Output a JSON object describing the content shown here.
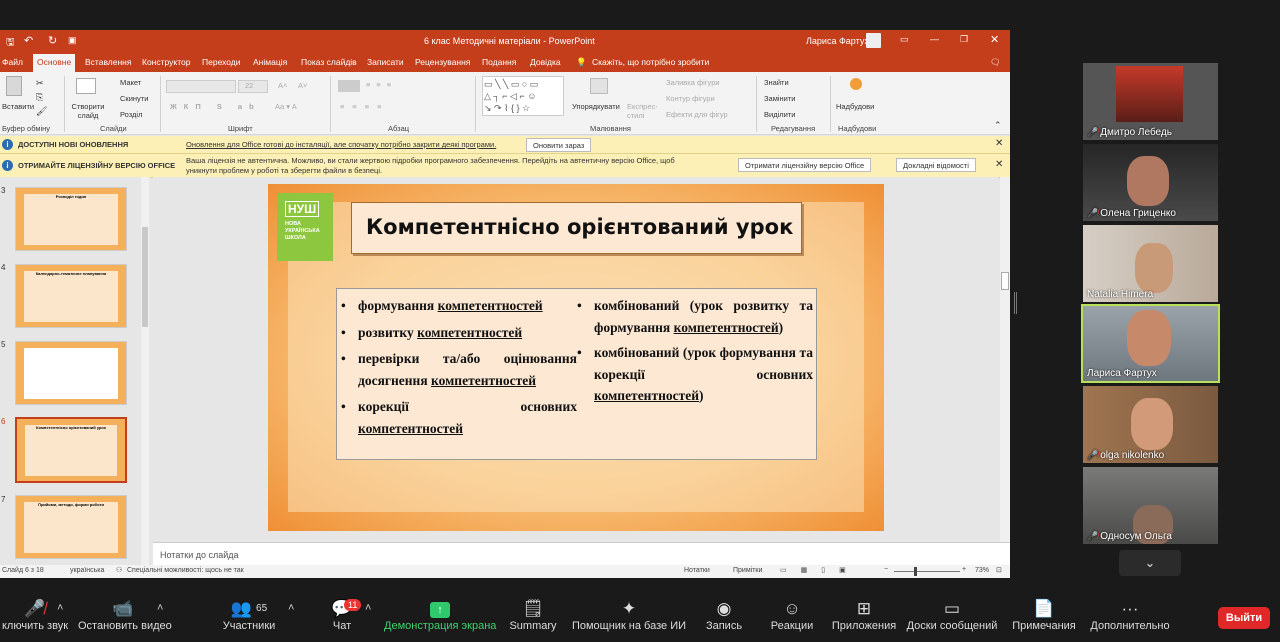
{
  "powerpoint": {
    "title": "6 клас Методичні матеріали  -  PowerPoint",
    "user": "Лариса Фартух",
    "tabs": [
      "Файл",
      "Основне",
      "Вставлення",
      "Конструктор",
      "Переходи",
      "Анімація",
      "Показ слайдів",
      "Записати",
      "Рецензування",
      "Подання",
      "Довідка"
    ],
    "tell_me": "Скажіть, що потрібно зробити",
    "ribbon": {
      "paste": "Вставити",
      "clipboard": "Буфер обміну",
      "new_slide": "Створити слайд",
      "layout": "Макет",
      "reset": "Скинути",
      "section": "Розділ",
      "slides": "Слайди",
      "font": "Шрифт",
      "font_size": "22",
      "paragraph": "Абзац",
      "arrange": "Упорядкувати",
      "quick_styles": "Експрес-стилі",
      "shape_fill": "Заливка фігури",
      "shape_outline": "Контур фігури",
      "shape_effects": "Ефекти для фігур",
      "drawing": "Малювання",
      "find": "Знайти",
      "replace": "Замінити",
      "select": "Виділити",
      "editing": "Редагування",
      "addins_btn": "Надбудови",
      "addins": "Надбудови"
    },
    "update_bar": {
      "title": "ДОСТУПНІ НОВІ ОНОВЛЕННЯ",
      "text": "Оновлення для Office готові до інсталяції, але спочатку потрібно закрити деякі програми.",
      "button": "Оновити зараз"
    },
    "license_bar": {
      "title": "ОТРИМАЙТЕ ЛІЦЕНЗІЙНУ ВЕРСІЮ OFFICE",
      "text1": "Ваша ліцензія не автентична. Можливо, ви стали жертвою підробки програмного забезпечення. Перейдіть на автентичну версію Office, щоб",
      "text2": "уникнути проблем у роботі та зберегти файли в безпеці.",
      "button1": "Отримати ліцензійну версію Office",
      "button2": "Докладні відомості"
    },
    "thumbnails": [
      {
        "num": "3",
        "title": "Розподіл годин"
      },
      {
        "num": "4",
        "title": "Календарно-тематичне планування"
      },
      {
        "num": "5",
        "title": ""
      },
      {
        "num": "6",
        "title": "Компетентнісно орієнтований урок"
      },
      {
        "num": "7",
        "title": "Прийоми, методи, форми роботи"
      }
    ],
    "slide": {
      "logo_big": "НУШ",
      "logo_sub1": "НОВА",
      "logo_sub2": "УКРАЇНСЬКА",
      "logo_sub3": "ШКОЛА",
      "title": "Компетентнісно орієнтований урок",
      "left_bullets": [
        {
          "pre": "формування ",
          "u": "компетентностей",
          "lines": 1
        },
        {
          "pre": "розвитку ",
          "u": "компетентностей",
          "lines": 1
        },
        {
          "pre": "перевірки та/або оцінювання досягнення ",
          "u": "компетентностей",
          "lines": 2
        },
        {
          "pre": "корекції основних ",
          "u": "компетентностей",
          "lines": 2
        }
      ],
      "right_bullets": [
        {
          "pre": "комбінований (урок розвитку та формування ",
          "u": "компетентностей",
          "post": ")"
        },
        {
          "pre": "комбінований (урок формування та корекції основних ",
          "u": "компетентностей",
          "post": ")"
        }
      ]
    },
    "notes_placeholder": "Нотатки до слайда",
    "status": {
      "slide": "Слайд 6 з 18",
      "language": "українська",
      "accessibility": "Спеціальні можливості: щось не так",
      "notes": "Нотатки",
      "comments": "Примітки",
      "zoom": "73%"
    }
  },
  "participants": [
    {
      "name": "Дмитро Лебедь",
      "muted": true,
      "bg": "#8a3a2a"
    },
    {
      "name": "Олена Гриценко",
      "muted": true,
      "bg": "#3a3a3a"
    },
    {
      "name": "Natalia Himera",
      "muted": false,
      "bg": "#b8a89a"
    },
    {
      "name": "Лариса Фартух",
      "muted": false,
      "bg": "#8a8f94"
    },
    {
      "name": "olga nikolenko",
      "muted": true,
      "bg": "#8a6a50"
    },
    {
      "name": "Односум Ольга",
      "muted": true,
      "bg": "#6a6a6a"
    }
  ],
  "toolbar": {
    "mute": "ключить звук",
    "video": "Остановить видео",
    "participants": "Участники",
    "participants_count": "65",
    "chat": "Чат",
    "chat_badge": "11",
    "share": "Демонстрация экрана",
    "summary": "Summary",
    "ai": "Помощник на базе ИИ",
    "record": "Запись",
    "reactions": "Реакции",
    "apps": "Приложения",
    "whiteboards": "Доски сообщений",
    "notes": "Примечания",
    "more": "Дополнительно",
    "leave": "Выйти"
  }
}
